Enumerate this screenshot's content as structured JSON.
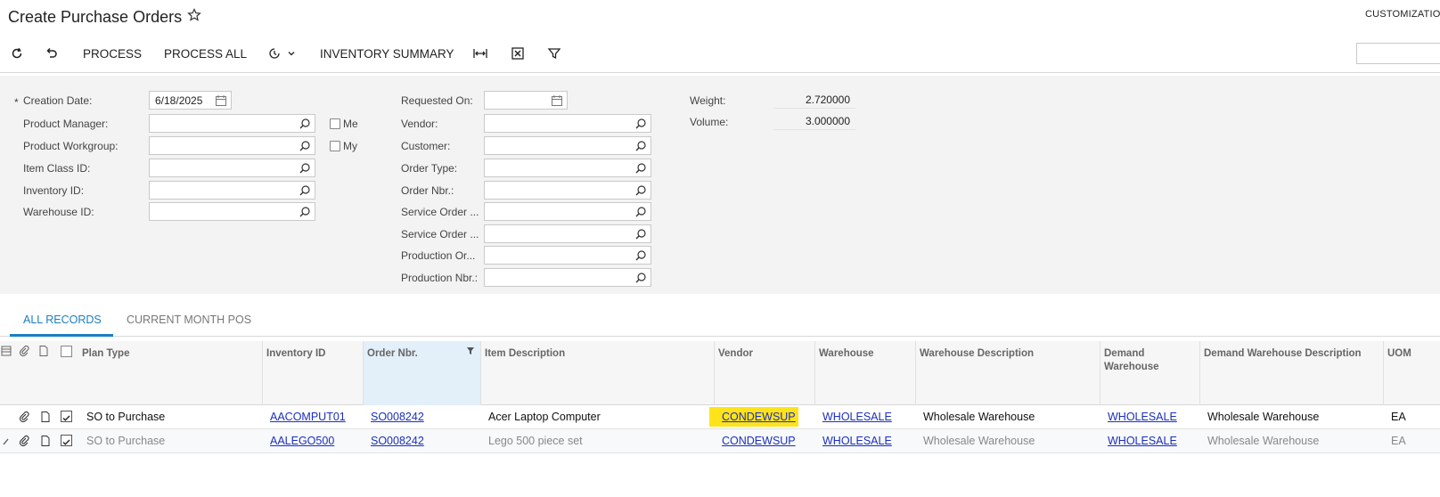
{
  "page": {
    "title": "Create Purchase Orders",
    "customization": "CUSTOMIZATION"
  },
  "toolbar": {
    "refresh_icon": "refresh-icon",
    "undo_icon": "undo-icon",
    "process_label": "PROCESS",
    "process_all_label": "PROCESS ALL",
    "schedule_icon": "schedule-icon",
    "inventory_summary_label": "INVENTORY SUMMARY",
    "fit_columns_icon": "fit-columns-icon",
    "export_excel_icon": "excel-icon",
    "filter_icon": "filter-icon",
    "search_value": ""
  },
  "filters": {
    "required_mark": "*",
    "creation_date_label": "Creation Date:",
    "creation_date_value": "6/18/2025",
    "product_manager_label": "Product Manager:",
    "product_workgroup_label": "Product Workgroup:",
    "item_class_label": "Item Class ID:",
    "inventory_id_label": "Inventory ID:",
    "warehouse_id_label": "Warehouse ID:",
    "me_label": "Me",
    "my_label": "My",
    "requested_on_label": "Requested On:",
    "vendor_label": "Vendor:",
    "customer_label": "Customer:",
    "order_type_label": "Order Type:",
    "order_nbr_label": "Order Nbr.:",
    "service_order_type_label": "Service Order ...",
    "service_order_nbr_label": "Service Order ...",
    "production_order_label": "Production Or...",
    "production_nbr_label": "Production Nbr.:",
    "weight_label": "Weight:",
    "weight_value": "2.720000",
    "volume_label": "Volume:",
    "volume_value": "3.000000"
  },
  "tabs": [
    {
      "label": "ALL RECORDS",
      "active": true
    },
    {
      "label": "CURRENT MONTH POS",
      "active": false
    }
  ],
  "grid": {
    "columns": {
      "plan_type": "Plan Type",
      "inventory_id": "Inventory ID",
      "order_nbr": "Order Nbr.",
      "item_description": "Item Description",
      "vendor": "Vendor",
      "warehouse": "Warehouse",
      "warehouse_description": "Warehouse Description",
      "demand_warehouse_line1": "Demand",
      "demand_warehouse_line2": "Warehouse",
      "demand_warehouse_description": "Demand Warehouse Description",
      "uom": "UOM"
    },
    "rows": [
      {
        "plan_type": "SO to Purchase",
        "inventory_id": "AACOMPUT01",
        "order_nbr": "SO008242",
        "item_description": "Acer Laptop Computer",
        "vendor": "CONDEWSUP",
        "warehouse": "WHOLESALE",
        "warehouse_description": "Wholesale Warehouse",
        "demand_warehouse": "WHOLESALE",
        "demand_warehouse_description": "Wholesale Warehouse",
        "uom": "EA",
        "selected": true
      },
      {
        "plan_type": "SO to Purchase",
        "inventory_id": "AALEGO500",
        "order_nbr": "SO008242",
        "item_description": "Lego 500 piece set",
        "vendor": "CONDEWSUP",
        "warehouse": "WHOLESALE",
        "warehouse_description": "Wholesale Warehouse",
        "demand_warehouse": "WHOLESALE",
        "demand_warehouse_description": "Wholesale Warehouse",
        "uom": "EA",
        "selected": true
      }
    ]
  },
  "colors": {
    "accent": "#1a7fc1",
    "link": "#1a2fbf",
    "highlight": "#ffe31a",
    "panel_bg": "#f3f3f3"
  }
}
